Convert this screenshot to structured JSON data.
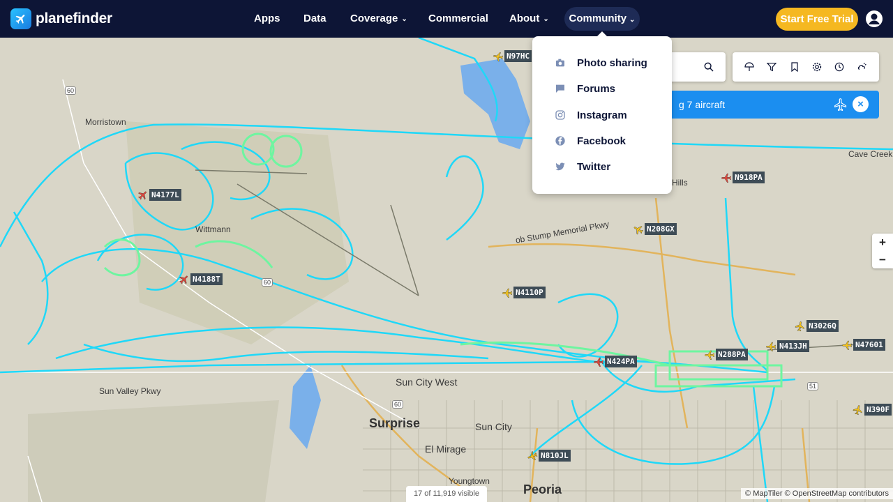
{
  "brand": {
    "name": "planefinder"
  },
  "nav": {
    "items": [
      "Apps",
      "Data",
      "Coverage",
      "Commercial",
      "About"
    ],
    "community": "Community",
    "cta": "Start Free Trial"
  },
  "community_menu": [
    {
      "label": "Photo sharing",
      "icon": "camera-icon"
    },
    {
      "label": "Forums",
      "icon": "chat-icon"
    },
    {
      "label": "Instagram",
      "icon": "instagram-icon"
    },
    {
      "label": "Facebook",
      "icon": "facebook-icon"
    },
    {
      "label": "Twitter",
      "icon": "twitter-icon"
    }
  ],
  "search": {
    "placeholder": "r"
  },
  "banner": {
    "text": "g 7 aircraft"
  },
  "map_labels": {
    "morristown": "Morristown",
    "wittmann": "Wittmann",
    "sun_city_west": "Sun City West",
    "surprise": "Surprise",
    "sun_city": "Sun City",
    "el_mirage": "El Mirage",
    "youngtown": "Youngtown",
    "peoria": "Peoria",
    "sun_valley_pkwy": "Sun Valley Pkwy",
    "cave_creek": "Cave Creek",
    "hills": "Hills",
    "stump_pkwy": "ob Stump Memorial Pkwy",
    "road_60a": "60",
    "road_60b": "60",
    "road_60c": "60",
    "road_51": "51"
  },
  "aircraft": [
    {
      "callsign": "N97HC",
      "color": "#f2c21c"
    },
    {
      "callsign": "N4177L",
      "color": "#e0453a"
    },
    {
      "callsign": "N918PA",
      "color": "#e0453a"
    },
    {
      "callsign": "N208GX",
      "color": "#f2c21c"
    },
    {
      "callsign": "N4188T",
      "color": "#e0453a"
    },
    {
      "callsign": "N4110P",
      "color": "#f2c21c"
    },
    {
      "callsign": "N3026Q",
      "color": "#f2c21c"
    },
    {
      "callsign": "N413JH",
      "color": "#f2c21c"
    },
    {
      "callsign": "N47601",
      "color": "#f2c21c"
    },
    {
      "callsign": "N288PA",
      "color": "#f2c21c"
    },
    {
      "callsign": "N424PA",
      "color": "#e0453a"
    },
    {
      "callsign": "N390F",
      "color": "#f2c21c"
    },
    {
      "callsign": "N810JL",
      "color": "#f2c21c"
    }
  ],
  "zoom": {
    "in": "+",
    "out": "−"
  },
  "footer": {
    "visible_count": "17 of 11,919 visible",
    "attribution": "© MapTiler © OpenStreetMap contributors"
  },
  "colors": {
    "nav_bg": "#0d1536",
    "cta": "#f5b821",
    "banner": "#1b8ef0",
    "track": "#1fd8f8",
    "track_green": "#6ef5a0"
  }
}
